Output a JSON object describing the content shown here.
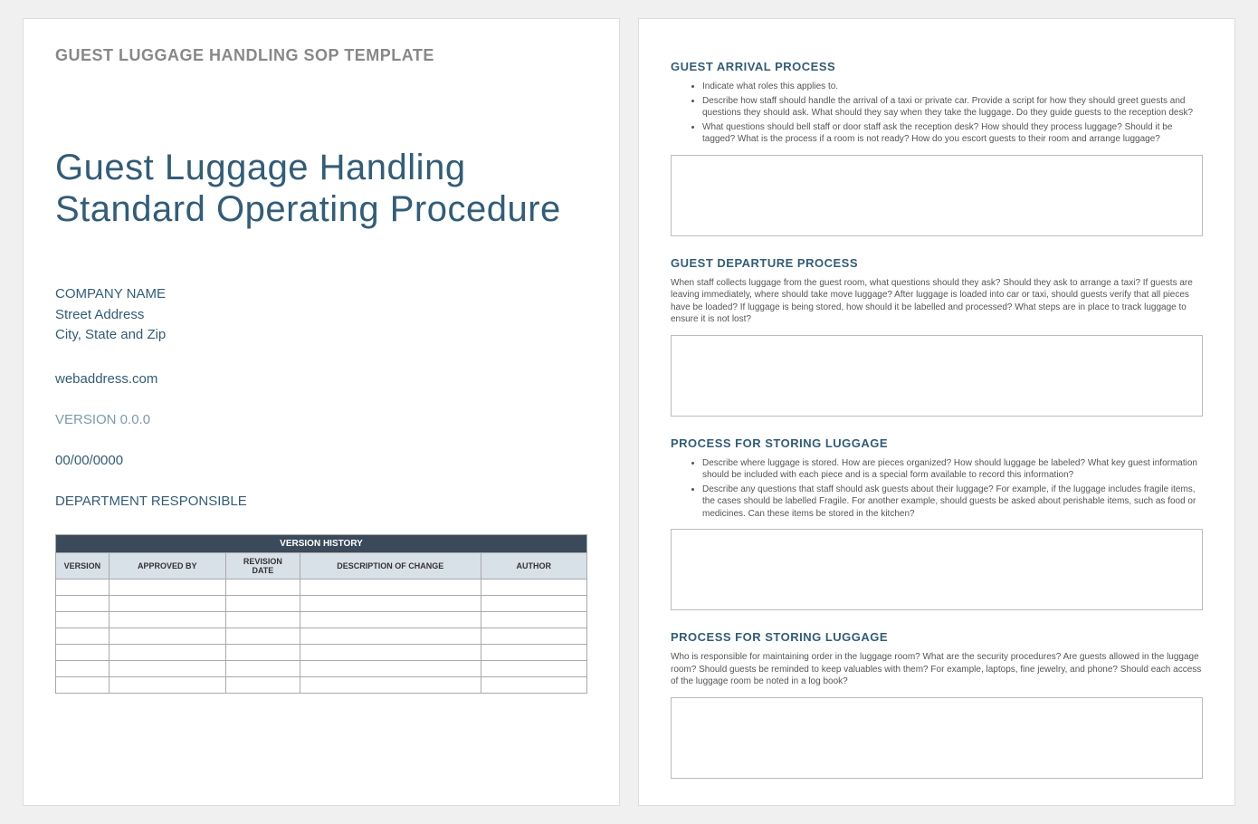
{
  "page1": {
    "template_header": "GUEST LUGGAGE HANDLING SOP TEMPLATE",
    "title": "Guest Luggage Handling Standard Operating Procedure",
    "company_name": "COMPANY NAME",
    "street": "Street Address",
    "city": "City, State and Zip",
    "web": "webaddress.com",
    "version": "VERSION 0.0.0",
    "date": "00/00/0000",
    "department": "DEPARTMENT RESPONSIBLE",
    "table": {
      "title": "VERSION HISTORY",
      "headers": [
        "VERSION",
        "APPROVED BY",
        "REVISION DATE",
        "DESCRIPTION OF CHANGE",
        "AUTHOR"
      ]
    }
  },
  "page2": {
    "sections": {
      "arrival": {
        "heading": "GUEST ARRIVAL PROCESS",
        "bullets": [
          "Indicate what roles this applies to.",
          "Describe how staff should handle the arrival of a taxi or private car. Provide a script for how they should greet guests and questions they should ask. What should they say when they take the luggage. Do they guide guests to the reception desk?",
          "What questions should bell staff or door staff ask the reception desk? How should they process luggage? Should it be tagged? What is the process if a room is not ready? How do you escort guests to their room and arrange luggage?"
        ]
      },
      "departure": {
        "heading": "GUEST DEPARTURE PROCESS",
        "para": "When staff collects luggage from the guest room, what questions should they ask? Should they ask to arrange a taxi? If guests are leaving immediately, where should take move luggage? After luggage is loaded into car or taxi, should guests verify that all pieces have be loaded? If luggage is being stored, how should it be labelled and processed? What steps are in place to track luggage to ensure it is not lost?"
      },
      "storing1": {
        "heading": "PROCESS FOR STORING LUGGAGE",
        "bullets": [
          "Describe where luggage is stored. How are pieces organized? How should luggage be labeled? What key guest information should be included with each piece and is a special form available to record this information?",
          "Describe any questions that staff should ask guests about their luggage? For example, if the luggage includes fragile items, the cases should be labelled Fragile. For another example, should guests be asked about perishable items, such as food or medicines. Can these items be stored in the kitchen?"
        ]
      },
      "storing2": {
        "heading": "PROCESS FOR STORING LUGGAGE",
        "para": "Who is responsible for maintaining order in the luggage room? What are the security procedures? Are guests allowed in the luggage room? Should guests be reminded to keep valuables with them? For example, laptops, fine jewelry, and phone? Should each access of the luggage room be noted in a log book?"
      }
    }
  }
}
